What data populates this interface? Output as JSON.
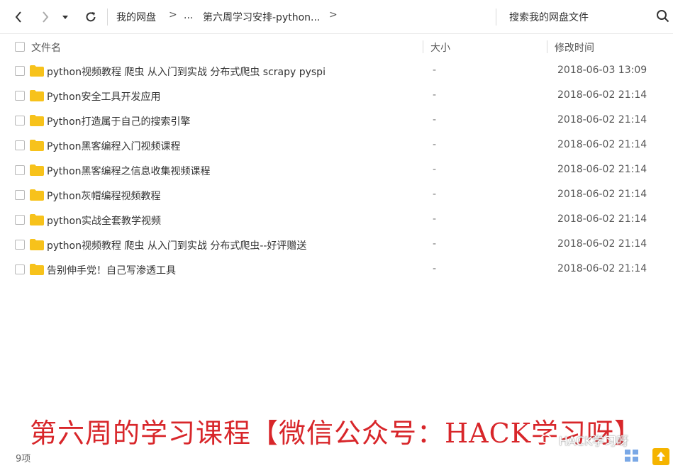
{
  "nav": {
    "breadcrumb": [
      "我的网盘",
      "...",
      "第六周学习安排-python..."
    ],
    "search_placeholder": "搜索我的网盘文件"
  },
  "columns": {
    "name": "文件名",
    "size": "大小",
    "modified": "修改时间"
  },
  "files": [
    {
      "name": "python视频教程 爬虫 从入门到实战 分布式爬虫 scrapy pyspi",
      "size": "-",
      "modified": "2018-06-03 13:09"
    },
    {
      "name": "Python安全工具开发应用",
      "size": "-",
      "modified": "2018-06-02 21:14"
    },
    {
      "name": "Python打造属于自己的搜索引擎",
      "size": "-",
      "modified": "2018-06-02 21:14"
    },
    {
      "name": "Python黑客编程入门视频课程",
      "size": "-",
      "modified": "2018-06-02 21:14"
    },
    {
      "name": "Python黑客编程之信息收集视频课程",
      "size": "-",
      "modified": "2018-06-02 21:14"
    },
    {
      "name": "Python灰帽编程视频教程",
      "size": "-",
      "modified": "2018-06-02 21:14"
    },
    {
      "name": "python实战全套教学视频",
      "size": "-",
      "modified": "2018-06-02 21:14"
    },
    {
      "name": "python视频教程 爬虫 从入门到实战 分布式爬虫--好评赠送",
      "size": "-",
      "modified": "2018-06-02 21:14"
    },
    {
      "name": "告别伸手党！自己写渗透工具",
      "size": "-",
      "modified": "2018-06-02 21:14"
    }
  ],
  "footer": {
    "item_count": "9项"
  },
  "overlay": {
    "caption": "第六周的学习课程【微信公众号：HACK学习呀】",
    "watermark": "HACK学习呀"
  },
  "colors": {
    "folder": "#f7c21b",
    "caption": "#d8262a",
    "upload": "#f5b400"
  },
  "icons": [
    "back-arrow-icon",
    "forward-arrow-icon",
    "dropdown-icon",
    "refresh-icon",
    "search-icon",
    "folder-icon",
    "grid-view-icon",
    "upload-icon"
  ]
}
